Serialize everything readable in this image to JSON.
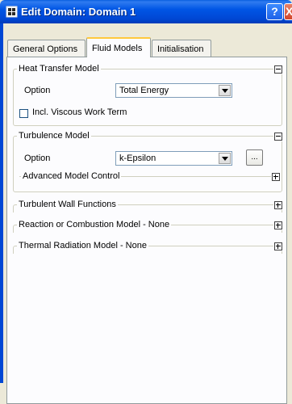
{
  "window": {
    "title": "Edit Domain: Domain 1",
    "help_label": "?",
    "close_label": "X"
  },
  "tabs": [
    {
      "label": "General Options",
      "selected": false
    },
    {
      "label": "Fluid Models",
      "selected": true
    },
    {
      "label": "Initialisation",
      "selected": false
    }
  ],
  "heat_transfer": {
    "title": "Heat Transfer Model",
    "option_label": "Option",
    "option_value": "Total Energy",
    "viscous_label": "Incl. Viscous Work Term",
    "viscous_checked": false,
    "expanded": true
  },
  "turbulence": {
    "title": "Turbulence Model",
    "option_label": "Option",
    "option_value": "k-Epsilon",
    "more_label": "...",
    "advanced_title": "Advanced Model Control",
    "expanded": true
  },
  "collapsed_groups": [
    {
      "title": "Turbulent Wall Functions"
    },
    {
      "title": "Reaction or Combustion Model - None"
    },
    {
      "title": "Thermal Radiation Model - None"
    }
  ],
  "colors": {
    "titlebar": "#0055e5",
    "selected_tab_highlight": "#ffc83c"
  }
}
